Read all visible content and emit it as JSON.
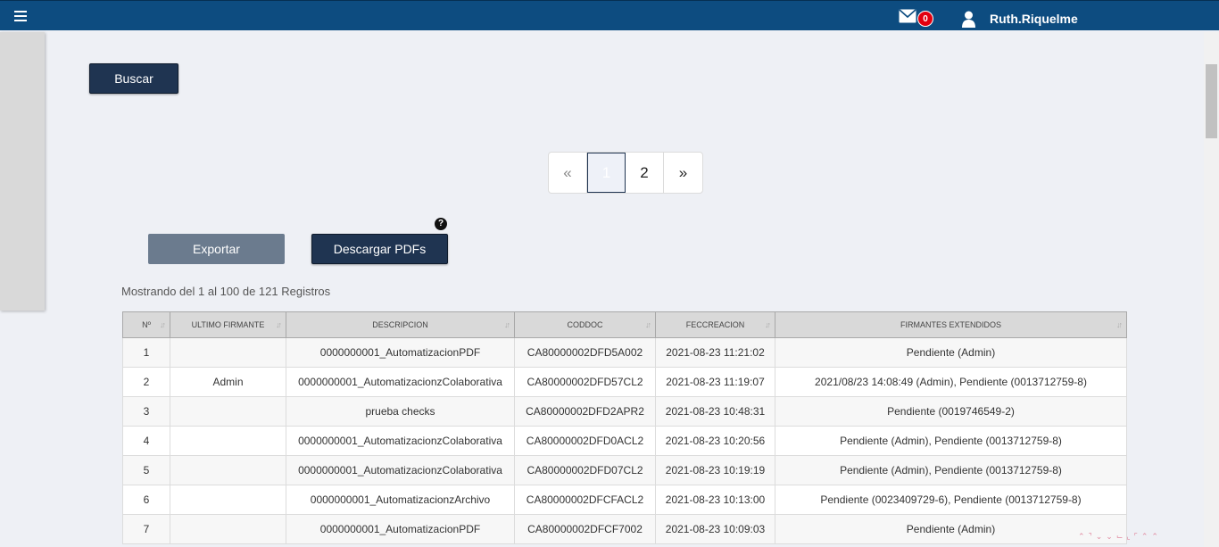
{
  "header": {
    "mail_count": "0",
    "user_name": "Ruth.Riquelme"
  },
  "search": {
    "button_label": "Buscar"
  },
  "pagination": {
    "prev": "«",
    "pages": [
      "1",
      "2"
    ],
    "next": "»",
    "active_page": "1"
  },
  "actions": {
    "export_label": "Exportar",
    "download_pdfs_label": "Descargar PDFs",
    "help_glyph": "?"
  },
  "table": {
    "info": "Mostrando del 1 al 100 de 121 Registros",
    "columns": [
      "Nº",
      "ULTIMO FIRMANTE",
      "DESCRIPCION",
      "CODDOC",
      "FECCREACION",
      "FIRMANTES EXTENDIDOS"
    ],
    "rows": [
      [
        "1",
        "",
        "0000000001_AutomatizacionPDF",
        "CA80000002DFD5A002",
        "2021-08-23 11:21:02",
        "Pendiente (Admin)"
      ],
      [
        "2",
        "Admin",
        "0000000001_AutomatizacionzColaborativa",
        "CA80000002DFD57CL2",
        "2021-08-23 11:19:07",
        "2021/08/23 14:08:49 (Admin), Pendiente (0013712759-8)"
      ],
      [
        "3",
        "",
        "prueba checks",
        "CA80000002DFD2APR2",
        "2021-08-23 10:48:31",
        "Pendiente (0019746549-2)"
      ],
      [
        "4",
        "",
        "0000000001_AutomatizacionzColaborativa",
        "CA80000002DFD0ACL2",
        "2021-08-23 10:20:56",
        "Pendiente (Admin), Pendiente (0013712759-8)"
      ],
      [
        "5",
        "",
        "0000000001_AutomatizacionzColaborativa",
        "CA80000002DFD07CL2",
        "2021-08-23 10:19:19",
        "Pendiente (Admin), Pendiente (0013712759-8)"
      ],
      [
        "6",
        "",
        "0000000001_AutomatizacionzArchivo",
        "CA80000002DFCFACL2",
        "2021-08-23 10:13:00",
        "Pendiente (0023409729-6), Pendiente (0013712759-8)"
      ],
      [
        "7",
        "",
        "0000000001_AutomatizacionPDF",
        "CA80000002DFCF7002",
        "2021-08-23 10:09:03",
        "Pendiente (Admin)"
      ]
    ]
  },
  "icons": [
    "menu-icon",
    "mail-icon",
    "user-icon",
    "help-icon",
    "sort-icon"
  ],
  "colors": {
    "topbar": "#0d4c80",
    "primary_button": "#1f3451",
    "secondary_button": "#6b7b8e",
    "badge": "#e3000f"
  }
}
